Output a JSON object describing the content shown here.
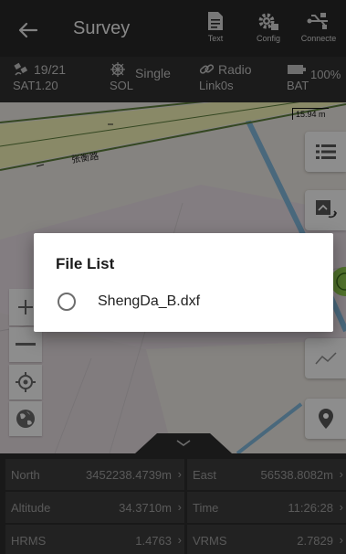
{
  "header": {
    "title": "Survey",
    "buttons": [
      {
        "label": "Text",
        "icon": "document-icon"
      },
      {
        "label": "Config",
        "icon": "gear-icon"
      },
      {
        "label": "Connecte",
        "icon": "usb-icon"
      }
    ]
  },
  "status": {
    "sat_count": "19/21",
    "sat_label": "SAT",
    "sat_value": "1.20",
    "sol_label": "SOL",
    "sol_value": "Single",
    "link_type": "Radio",
    "link_label": "Link",
    "link_value": "0s",
    "bat_label": "BAT",
    "bat_value": "100%"
  },
  "map": {
    "scale_label": "15.94 m",
    "road_label": "张衡路"
  },
  "data_panel": {
    "north": {
      "label": "North",
      "value": "3452238.4739m"
    },
    "east": {
      "label": "East",
      "value": "56538.8082m"
    },
    "altitude": {
      "label": "Altitude",
      "value": "34.3710m"
    },
    "time": {
      "label": "Time",
      "value": "11:26:28"
    },
    "hrms": {
      "label": "HRMS",
      "value": "1.4763"
    },
    "vrms": {
      "label": "VRMS",
      "value": "2.7829"
    }
  },
  "dialog": {
    "title": "File List",
    "files": [
      {
        "name": "ShengDa_B.dxf",
        "selected": false
      }
    ]
  },
  "colors": {
    "header_bg": "#262626",
    "status_bg": "#2f2f2f",
    "map_bg": "#e6e2dc",
    "road_yellow": "#e9e9a8",
    "road_green": "#5a7a3a",
    "water_blue": "#7fb3d6",
    "accent_green": "#8bc34a"
  }
}
